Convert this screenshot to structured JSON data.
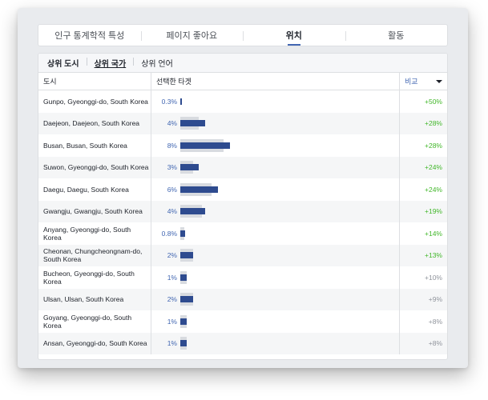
{
  "tabs": [
    {
      "label": "인구 통계학적 특성"
    },
    {
      "label": "페이지 좋아요"
    },
    {
      "label": "위치"
    },
    {
      "label": "활동"
    }
  ],
  "active_tab": "위치",
  "subtabs": [
    {
      "label": "상위 도시"
    },
    {
      "label": "상위 국가"
    },
    {
      "label": "상위 언어"
    }
  ],
  "table": {
    "col_city": "도시",
    "col_target": "선택한 타겟",
    "col_compare": "비교",
    "rows": [
      {
        "city": "Gunpo, Gyeonggi-do, South Korea",
        "pct": "0.3%",
        "value": 0.3,
        "compare_value": null,
        "compare": "+50%"
      },
      {
        "city": "Daejeon, Daejeon, South Korea",
        "pct": "4%",
        "value": 4,
        "compare_value": 3,
        "compare": "+28%"
      },
      {
        "city": "Busan, Busan, South Korea",
        "pct": "8%",
        "value": 8,
        "compare_value": 7,
        "compare": "+28%"
      },
      {
        "city": "Suwon, Gyeonggi-do, South Korea",
        "pct": "3%",
        "value": 3,
        "compare_value": 2,
        "compare": "+24%"
      },
      {
        "city": "Daegu, Daegu, South Korea",
        "pct": "6%",
        "value": 6,
        "compare_value": 5,
        "compare": "+24%"
      },
      {
        "city": "Gwangju, Gwangju, South Korea",
        "pct": "4%",
        "value": 4,
        "compare_value": 3.5,
        "compare": "+19%"
      },
      {
        "city": "Anyang, Gyeonggi-do, South Korea",
        "pct": "0.8%",
        "value": 0.8,
        "compare_value": 0.7,
        "compare": "+14%"
      },
      {
        "city": "Cheonan, Chungcheongnam-do, South Korea",
        "pct": "2%",
        "value": 2,
        "compare_value": 2,
        "compare": "+13%"
      },
      {
        "city": "Bucheon, Gyeonggi-do, South Korea",
        "pct": "1%",
        "value": 1,
        "compare_value": 1,
        "compare": "+10%"
      },
      {
        "city": "Ulsan, Ulsan, South Korea",
        "pct": "2%",
        "value": 2,
        "compare_value": 2,
        "compare": "+9%"
      },
      {
        "city": "Goyang, Gyeonggi-do, South Korea",
        "pct": "1%",
        "value": 1,
        "compare_value": 1,
        "compare": "+8%"
      },
      {
        "city": "Ansan, Gyeonggi-do, South Korea",
        "pct": "1%",
        "value": 1,
        "compare_value": 1,
        "compare": "+8%"
      }
    ]
  },
  "colors": {
    "bar": "#2e4b8f",
    "compare_bar": "#d8dbe0",
    "positive": "#42b72a",
    "neutral": "#90949c",
    "accent": "#4267b2"
  }
}
